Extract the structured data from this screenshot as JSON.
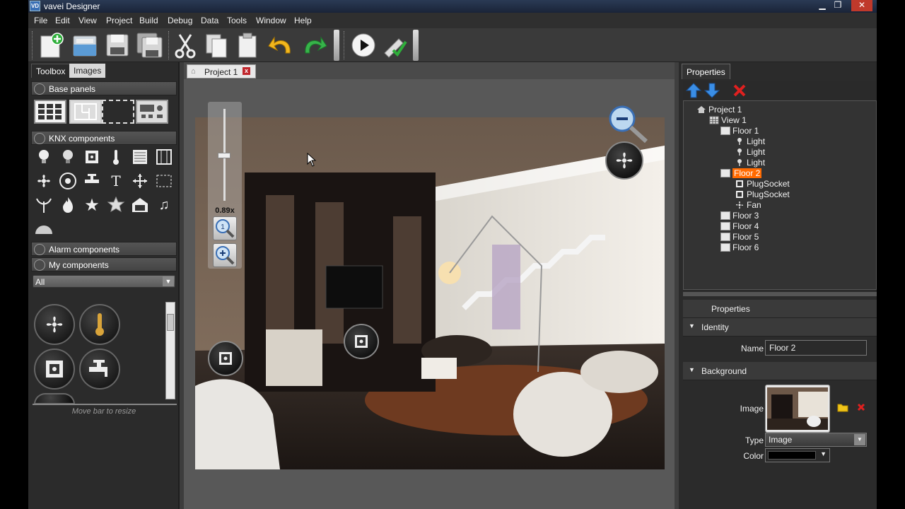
{
  "window": {
    "app_icon": "VD",
    "title": "vavei Designer",
    "minimize": "▁",
    "restore": "❐",
    "close": "✕"
  },
  "menu": [
    "File",
    "Edit",
    "View",
    "Project",
    "Build",
    "Debug",
    "Data",
    "Tools",
    "Window",
    "Help"
  ],
  "left_panel": {
    "tabs": [
      "Toolbox",
      "Images"
    ],
    "sections": {
      "base_panels": "Base panels",
      "knx_components": "KNX components",
      "alarm_components": "Alarm components",
      "my_components": "My components"
    },
    "filter_value": "All",
    "resize_hint": "Move bar to resize"
  },
  "document": {
    "tab_title": "Project 1",
    "zoom_level": "0.89x"
  },
  "right_panel": {
    "tab": "Properties",
    "tree": [
      {
        "label": "Project 1",
        "level": 0,
        "icon": "home-icon"
      },
      {
        "label": "View 1",
        "level": 1,
        "icon": "grid-icon"
      },
      {
        "label": "Floor 1",
        "level": 2,
        "icon": "floor-icon"
      },
      {
        "label": "Light",
        "level": 3,
        "icon": "light-icon"
      },
      {
        "label": "Light",
        "level": 3,
        "icon": "light-icon"
      },
      {
        "label": "Light",
        "level": 3,
        "icon": "light-icon"
      },
      {
        "label": "Floor 2",
        "level": 2,
        "icon": "floor-icon",
        "selected": true
      },
      {
        "label": "PlugSocket",
        "level": 3,
        "icon": "socket-icon"
      },
      {
        "label": "PlugSocket",
        "level": 3,
        "icon": "socket-icon"
      },
      {
        "label": "Fan",
        "level": 3,
        "icon": "fan-icon"
      },
      {
        "label": "Floor 3",
        "level": 2,
        "icon": "floor-icon"
      },
      {
        "label": "Floor 4",
        "level": 2,
        "icon": "floor-icon"
      },
      {
        "label": "Floor 5",
        "level": 2,
        "icon": "floor-icon"
      },
      {
        "label": "Floor 6",
        "level": 2,
        "icon": "floor-icon"
      }
    ],
    "properties": {
      "header": "Properties",
      "identity_group": "Identity",
      "name_label": "Name",
      "name_value": "Floor 2",
      "background_group": "Background",
      "image_label": "Image",
      "type_label": "Type",
      "type_value": "Image",
      "color_label": "Color",
      "color_value": "#000000"
    }
  },
  "colors": {
    "selection": "#ff6a00",
    "close_red": "#c0262c",
    "panel_bg": "#2b2b2b"
  }
}
